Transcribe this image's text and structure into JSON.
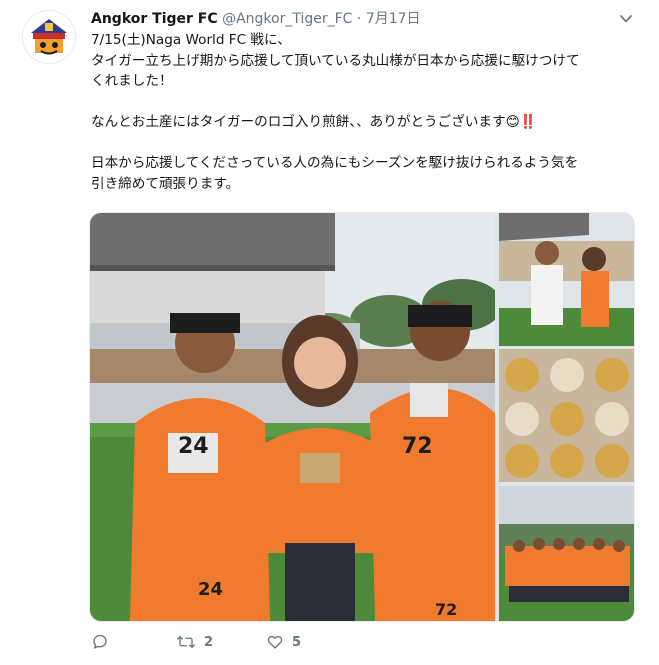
{
  "tweet": {
    "display_name": "Angkor Tiger FC",
    "handle": "@Angkor_Tiger_FC",
    "separator": "·",
    "date": "7月17日",
    "lines": [
      "7/15(土)Naga World FC 戦に、",
      "タイガー立ち上げ期から応援して頂いている丸山様が日本から応援に駆けつけて",
      "くれました！",
      "",
      "なんとお土産にはタイガーのロゴ入り煎餅、、ありがとうございます😊‼️",
      "",
      "日本から応援してくださっている人の為にもシーズンを駆け抜けられるよう気を",
      "引き締めて頑張ります。"
    ],
    "jersey_numbers": [
      "24",
      "72",
      "24",
      "72"
    ]
  },
  "actions": {
    "reply_count": "",
    "retweet_count": "2",
    "like_count": "5"
  },
  "icons": {
    "caret": "chevron-down-icon",
    "reply": "reply-icon",
    "retweet": "retweet-icon",
    "like": "heart-icon"
  },
  "colors": {
    "text": "#14171a",
    "secondary": "#657786",
    "jersey_orange": "#f07a2e",
    "field_green": "#4d8a3a"
  }
}
